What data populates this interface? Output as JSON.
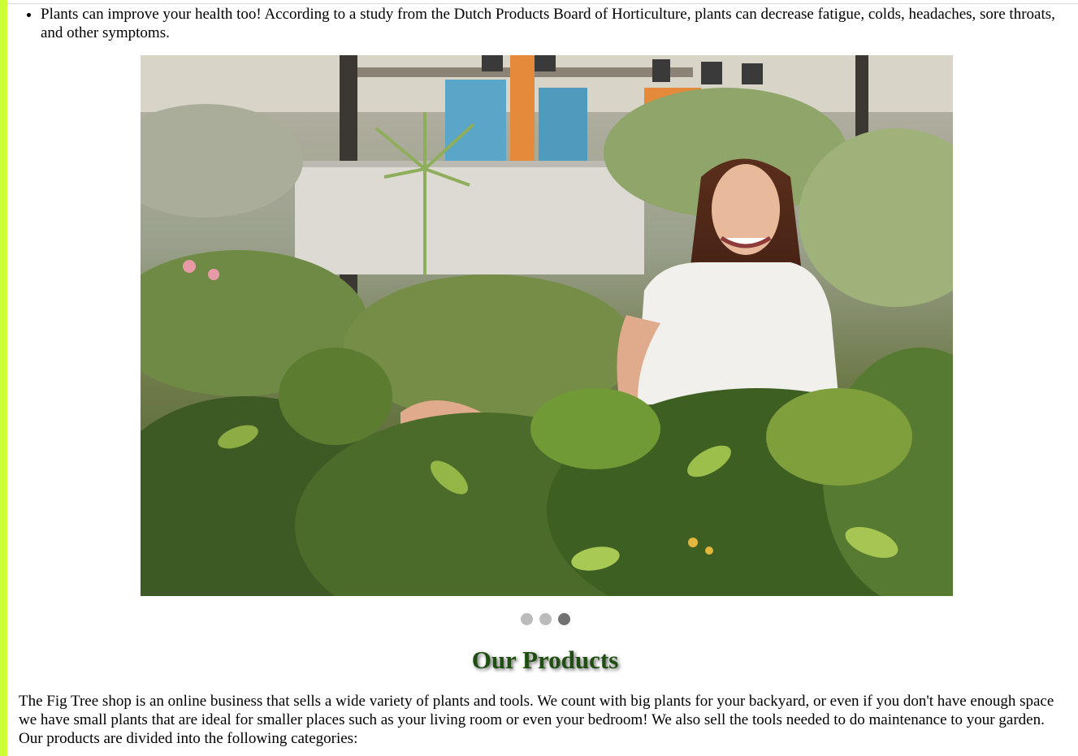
{
  "benefits": {
    "items": [
      "Plants can improve your health too! According to a study from the Dutch Products Board of Horticulture, plants can decrease fatigue, colds, headaches, sore throats, and other symptoms."
    ]
  },
  "slideshow": {
    "image_alt": "",
    "slide_count": 3,
    "active_slide": 3
  },
  "products": {
    "title": "Our Products",
    "intro": "The Fig Tree shop is an online business that sells a wide variety of plants and tools. We count with big plants for your backyard, or even if you don't have enough space we have small plants that are ideal for smaller places such as your living room or even your bedroom! We also sell the tools needed to do maintenance to your garden. Our products are divided into the following categories:"
  },
  "colors": {
    "accent_bar": "#ccff33",
    "title": "#1f4d12",
    "dot": "#bbbbbb",
    "dot_active": "#717171"
  }
}
